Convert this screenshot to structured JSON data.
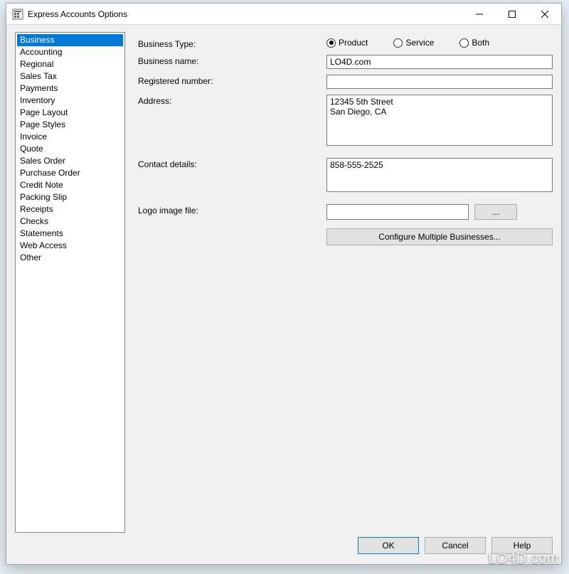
{
  "window": {
    "title": "Express Accounts Options"
  },
  "sidebar": {
    "items": [
      "Business",
      "Accounting",
      "Regional",
      "Sales Tax",
      "Payments",
      "Inventory",
      "Page Layout",
      "Page Styles",
      "Invoice",
      "Quote",
      "Sales Order",
      "Purchase Order",
      "Credit Note",
      "Packing Slip",
      "Receipts",
      "Checks",
      "Statements",
      "Web Access",
      "Other"
    ],
    "selected_index": 0
  },
  "form": {
    "business_type": {
      "label": "Business Type:",
      "options": {
        "product": "Product",
        "service": "Service",
        "both": "Both"
      },
      "selected": "product"
    },
    "business_name": {
      "label": "Business name:",
      "value": "LO4D.com"
    },
    "registered_number": {
      "label": "Registered number:",
      "value": ""
    },
    "address": {
      "label": "Address:",
      "value": "12345 5th Street\nSan Diego, CA"
    },
    "contact": {
      "label": "Contact details:",
      "value": "858-555-2525"
    },
    "logo": {
      "label": "Logo image file:",
      "value": "",
      "browse": "..."
    },
    "configure_button": "Configure Multiple Businesses..."
  },
  "footer": {
    "ok": "OK",
    "cancel": "Cancel",
    "help": "Help"
  },
  "watermark": "LO4D.com"
}
